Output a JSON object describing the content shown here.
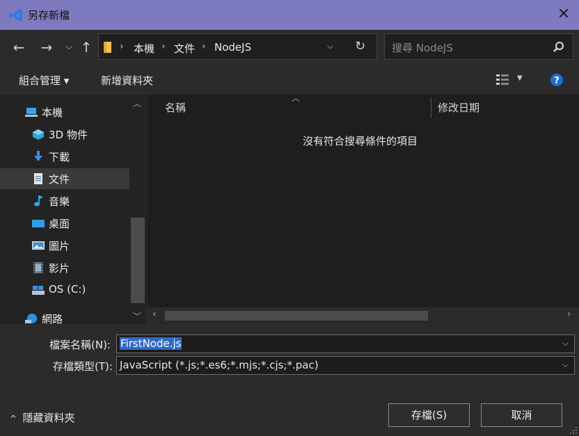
{
  "window": {
    "title": "另存新檔"
  },
  "address": {
    "crumbs": [
      "本機",
      "文件",
      "NodeJS"
    ],
    "search_placeholder": "搜尋 NodeJS"
  },
  "toolbar": {
    "organize": "組合管理 ▾",
    "new_folder": "新增資料夾"
  },
  "nav": {
    "items": [
      {
        "label": "本機",
        "icon": "computer-icon"
      },
      {
        "label": "3D 物件",
        "icon": "cube-icon"
      },
      {
        "label": "下載",
        "icon": "download-icon"
      },
      {
        "label": "文件",
        "icon": "document-icon"
      },
      {
        "label": "音樂",
        "icon": "music-icon"
      },
      {
        "label": "桌面",
        "icon": "desktop-icon"
      },
      {
        "label": "圖片",
        "icon": "pictures-icon"
      },
      {
        "label": "影片",
        "icon": "video-icon"
      },
      {
        "label": "OS (C:)",
        "icon": "drive-icon"
      },
      {
        "label": "網路",
        "icon": "network-icon"
      }
    ]
  },
  "content": {
    "col_name": "名稱",
    "col_date": "修改日期",
    "empty": "沒有符合搜尋條件的項目"
  },
  "form": {
    "filename_label": "檔案名稱(N):",
    "filename_value": "FirstNode.js",
    "filetype_label": "存檔類型(T):",
    "filetype_value": "JavaScript (*.js;*.es6;*.mjs;*.cjs;*.pac)",
    "hide_folders": "隱藏資料夾",
    "save": "存檔(S)",
    "cancel": "取消"
  },
  "colors": {
    "titlebar": "#7e7ac0",
    "accent": "#3169c6",
    "help": "#1a6fd6"
  }
}
